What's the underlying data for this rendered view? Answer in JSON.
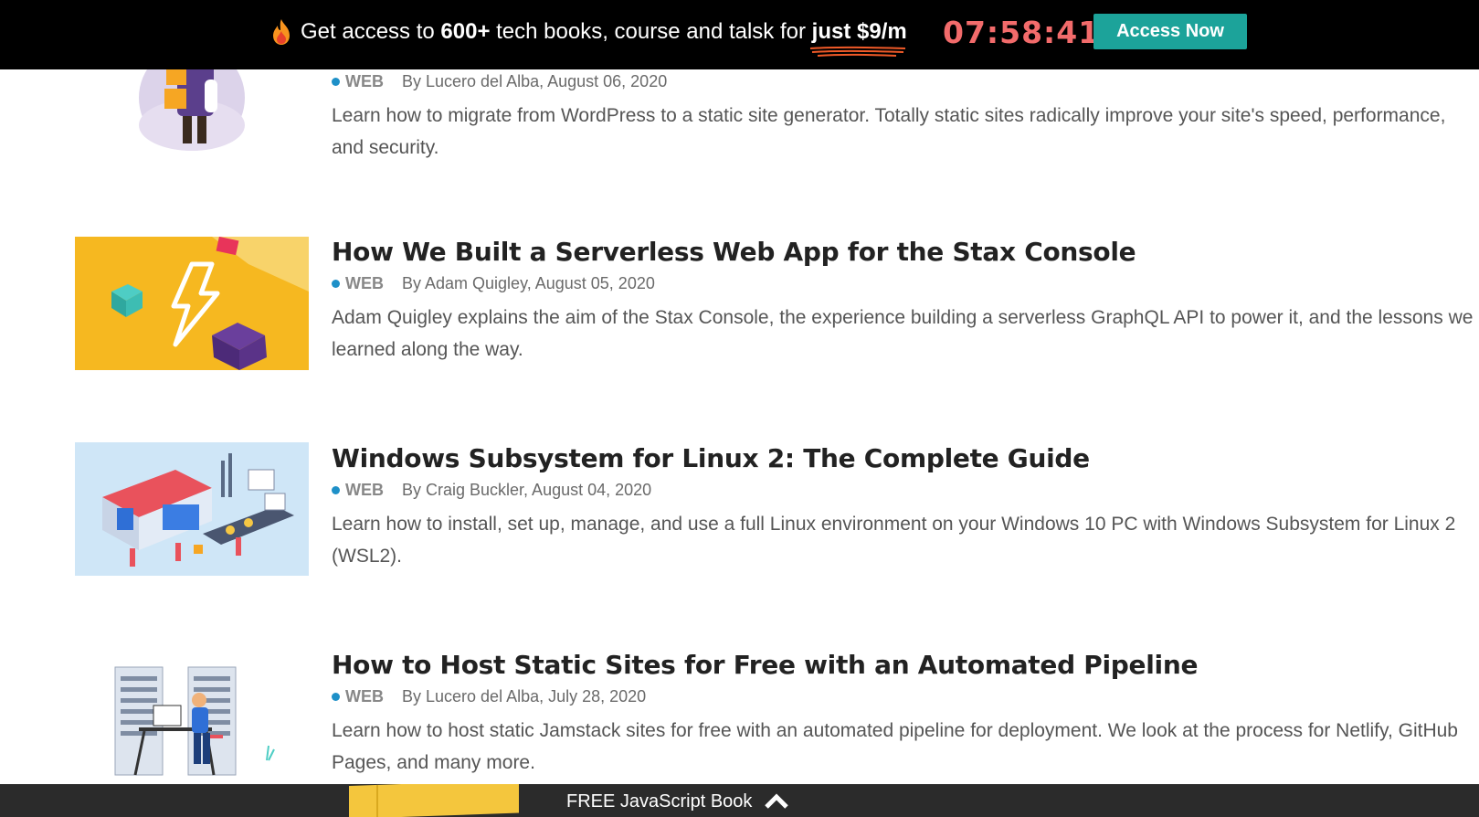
{
  "promo": {
    "icon": "fire-icon",
    "text_before": "Get access to ",
    "count": "600+",
    "text_middle": " tech books, course and talsk for ",
    "price": "just $9/m",
    "countdown": "07:58:41",
    "button_label": "Access Now",
    "colors": {
      "background": "#000000",
      "countdown": "#f26b6b",
      "button": "#1ca39a"
    }
  },
  "articles": [
    {
      "title": "",
      "category": "WEB",
      "byline": "By Lucero del Alba, August 06, 2020",
      "excerpt": "Learn how to migrate from WordPress to a static site generator. Totally static sites radically improve your site's speed, performance, and security.",
      "thumbnail": "wordpress-migration-illustration"
    },
    {
      "title": "How We Built a Serverless Web App for the Stax Console",
      "category": "WEB",
      "byline": "By Adam Quigley, August 05, 2020",
      "excerpt": "Adam Quigley explains the aim of the Stax Console, the experience building a serverless GraphQL API to power it, and the lessons we learned along the way.",
      "thumbnail": "serverless-lightning-illustration"
    },
    {
      "title": "Windows Subsystem for Linux 2: The Complete Guide",
      "category": "WEB",
      "byline": "By Craig Buckler, August 04, 2020",
      "excerpt": "Learn how to install, set up, manage, and use a full Linux environment on your Windows 10 PC with Windows Subsystem for Linux 2 (WSL2).",
      "thumbnail": "isometric-factory-illustration"
    },
    {
      "title": "How to Host Static Sites for Free with an Automated Pipeline",
      "category": "WEB",
      "byline": "By Lucero del Alba, July 28, 2020",
      "excerpt": "Learn how to host static Jamstack sites for free with an automated pipeline for deployment. We look at the process for Netlify, GitHub Pages, and many more.",
      "thumbnail": "server-rack-developer-illustration"
    }
  ],
  "bottom_bar": {
    "label": "FREE JavaScript Book",
    "icon": "chevron-up-icon"
  },
  "colors": {
    "category_dot": "#1e90c8",
    "title": "#222222",
    "excerpt": "#555555"
  }
}
